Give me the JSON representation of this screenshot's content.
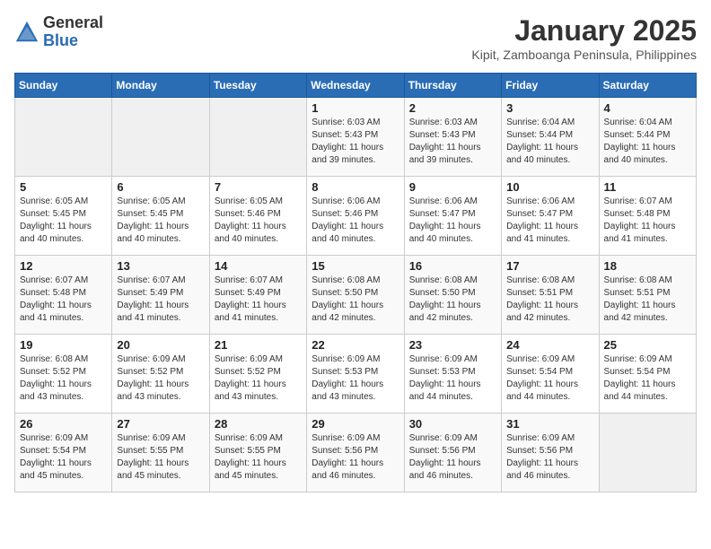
{
  "header": {
    "logo_general": "General",
    "logo_blue": "Blue",
    "month_title": "January 2025",
    "location": "Kipit, Zamboanga Peninsula, Philippines"
  },
  "days_of_week": [
    "Sunday",
    "Monday",
    "Tuesday",
    "Wednesday",
    "Thursday",
    "Friday",
    "Saturday"
  ],
  "weeks": [
    [
      {
        "day": "",
        "info": ""
      },
      {
        "day": "",
        "info": ""
      },
      {
        "day": "",
        "info": ""
      },
      {
        "day": "1",
        "info": "Sunrise: 6:03 AM\nSunset: 5:43 PM\nDaylight: 11 hours\nand 39 minutes."
      },
      {
        "day": "2",
        "info": "Sunrise: 6:03 AM\nSunset: 5:43 PM\nDaylight: 11 hours\nand 39 minutes."
      },
      {
        "day": "3",
        "info": "Sunrise: 6:04 AM\nSunset: 5:44 PM\nDaylight: 11 hours\nand 40 minutes."
      },
      {
        "day": "4",
        "info": "Sunrise: 6:04 AM\nSunset: 5:44 PM\nDaylight: 11 hours\nand 40 minutes."
      }
    ],
    [
      {
        "day": "5",
        "info": "Sunrise: 6:05 AM\nSunset: 5:45 PM\nDaylight: 11 hours\nand 40 minutes."
      },
      {
        "day": "6",
        "info": "Sunrise: 6:05 AM\nSunset: 5:45 PM\nDaylight: 11 hours\nand 40 minutes."
      },
      {
        "day": "7",
        "info": "Sunrise: 6:05 AM\nSunset: 5:46 PM\nDaylight: 11 hours\nand 40 minutes."
      },
      {
        "day": "8",
        "info": "Sunrise: 6:06 AM\nSunset: 5:46 PM\nDaylight: 11 hours\nand 40 minutes."
      },
      {
        "day": "9",
        "info": "Sunrise: 6:06 AM\nSunset: 5:47 PM\nDaylight: 11 hours\nand 40 minutes."
      },
      {
        "day": "10",
        "info": "Sunrise: 6:06 AM\nSunset: 5:47 PM\nDaylight: 11 hours\nand 41 minutes."
      },
      {
        "day": "11",
        "info": "Sunrise: 6:07 AM\nSunset: 5:48 PM\nDaylight: 11 hours\nand 41 minutes."
      }
    ],
    [
      {
        "day": "12",
        "info": "Sunrise: 6:07 AM\nSunset: 5:48 PM\nDaylight: 11 hours\nand 41 minutes."
      },
      {
        "day": "13",
        "info": "Sunrise: 6:07 AM\nSunset: 5:49 PM\nDaylight: 11 hours\nand 41 minutes."
      },
      {
        "day": "14",
        "info": "Sunrise: 6:07 AM\nSunset: 5:49 PM\nDaylight: 11 hours\nand 41 minutes."
      },
      {
        "day": "15",
        "info": "Sunrise: 6:08 AM\nSunset: 5:50 PM\nDaylight: 11 hours\nand 42 minutes."
      },
      {
        "day": "16",
        "info": "Sunrise: 6:08 AM\nSunset: 5:50 PM\nDaylight: 11 hours\nand 42 minutes."
      },
      {
        "day": "17",
        "info": "Sunrise: 6:08 AM\nSunset: 5:51 PM\nDaylight: 11 hours\nand 42 minutes."
      },
      {
        "day": "18",
        "info": "Sunrise: 6:08 AM\nSunset: 5:51 PM\nDaylight: 11 hours\nand 42 minutes."
      }
    ],
    [
      {
        "day": "19",
        "info": "Sunrise: 6:08 AM\nSunset: 5:52 PM\nDaylight: 11 hours\nand 43 minutes."
      },
      {
        "day": "20",
        "info": "Sunrise: 6:09 AM\nSunset: 5:52 PM\nDaylight: 11 hours\nand 43 minutes."
      },
      {
        "day": "21",
        "info": "Sunrise: 6:09 AM\nSunset: 5:52 PM\nDaylight: 11 hours\nand 43 minutes."
      },
      {
        "day": "22",
        "info": "Sunrise: 6:09 AM\nSunset: 5:53 PM\nDaylight: 11 hours\nand 43 minutes."
      },
      {
        "day": "23",
        "info": "Sunrise: 6:09 AM\nSunset: 5:53 PM\nDaylight: 11 hours\nand 44 minutes."
      },
      {
        "day": "24",
        "info": "Sunrise: 6:09 AM\nSunset: 5:54 PM\nDaylight: 11 hours\nand 44 minutes."
      },
      {
        "day": "25",
        "info": "Sunrise: 6:09 AM\nSunset: 5:54 PM\nDaylight: 11 hours\nand 44 minutes."
      }
    ],
    [
      {
        "day": "26",
        "info": "Sunrise: 6:09 AM\nSunset: 5:54 PM\nDaylight: 11 hours\nand 45 minutes."
      },
      {
        "day": "27",
        "info": "Sunrise: 6:09 AM\nSunset: 5:55 PM\nDaylight: 11 hours\nand 45 minutes."
      },
      {
        "day": "28",
        "info": "Sunrise: 6:09 AM\nSunset: 5:55 PM\nDaylight: 11 hours\nand 45 minutes."
      },
      {
        "day": "29",
        "info": "Sunrise: 6:09 AM\nSunset: 5:56 PM\nDaylight: 11 hours\nand 46 minutes."
      },
      {
        "day": "30",
        "info": "Sunrise: 6:09 AM\nSunset: 5:56 PM\nDaylight: 11 hours\nand 46 minutes."
      },
      {
        "day": "31",
        "info": "Sunrise: 6:09 AM\nSunset: 5:56 PM\nDaylight: 11 hours\nand 46 minutes."
      },
      {
        "day": "",
        "info": ""
      }
    ]
  ]
}
